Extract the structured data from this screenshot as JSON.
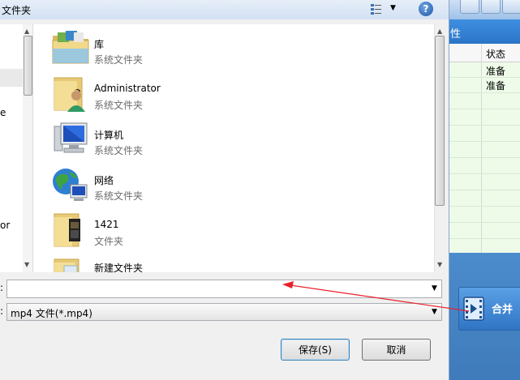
{
  "dialog": {
    "title": "文件夹",
    "help_label": "?",
    "filename_label": ":",
    "filetype_label": ":",
    "filename_value": "",
    "filetype_value": "mp4 文件(*.mp4)",
    "save_label": "保存(S)",
    "cancel_label": "取消"
  },
  "nav": {
    "items": [
      {
        "label": "e"
      },
      {
        "label": "or"
      }
    ]
  },
  "files": [
    {
      "name": "库",
      "type": "系统文件夹",
      "icon": "library-folder-icon"
    },
    {
      "name": "Administrator",
      "type": "系统文件夹",
      "icon": "user-folder-icon"
    },
    {
      "name": "计算机",
      "type": "系统文件夹",
      "icon": "computer-icon"
    },
    {
      "name": "网络",
      "type": "系统文件夹",
      "icon": "network-icon"
    },
    {
      "name": "1421",
      "type": "文件夹",
      "icon": "folder-icon"
    },
    {
      "name": "新建文件夹",
      "type": "",
      "icon": "folder-icon"
    }
  ],
  "bgapp": {
    "tab_text": "性",
    "column_header": "状态",
    "rows": [
      "准备",
      "准备"
    ],
    "merge_label": "合并"
  },
  "colors": {
    "dialog_bg": "#f0f0f0",
    "accent": "#3c7fb1",
    "bgapp_blue": "#4a86c4",
    "grid_green": "#eefbe9",
    "annotation_red": "#e8202a"
  }
}
